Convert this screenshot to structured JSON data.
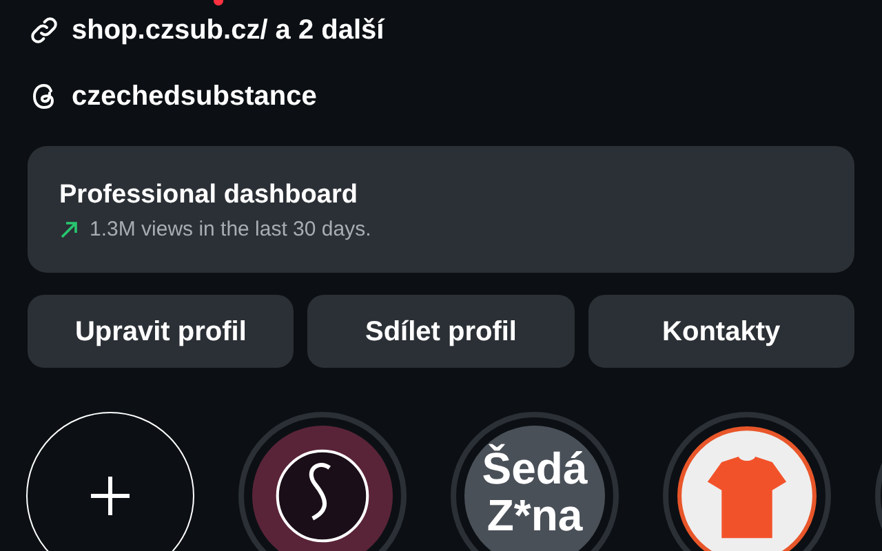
{
  "link": {
    "text": "shop.czsub.cz/ a 2 další"
  },
  "threads": {
    "text": "czechedsubstance"
  },
  "dashboard": {
    "title": "Professional dashboard",
    "stat": "1.3M views in the last 30 days."
  },
  "buttons": [
    "Upravit profil",
    "Sdílet profil",
    "Kontakty"
  ],
  "highlights": [
    {
      "kind": "add"
    },
    {
      "kind": "swirl-logo"
    },
    {
      "kind": "text-logo",
      "lines": [
        "Šedá",
        "Z*na"
      ]
    },
    {
      "kind": "shirt-logo"
    },
    {
      "kind": "partial"
    }
  ]
}
